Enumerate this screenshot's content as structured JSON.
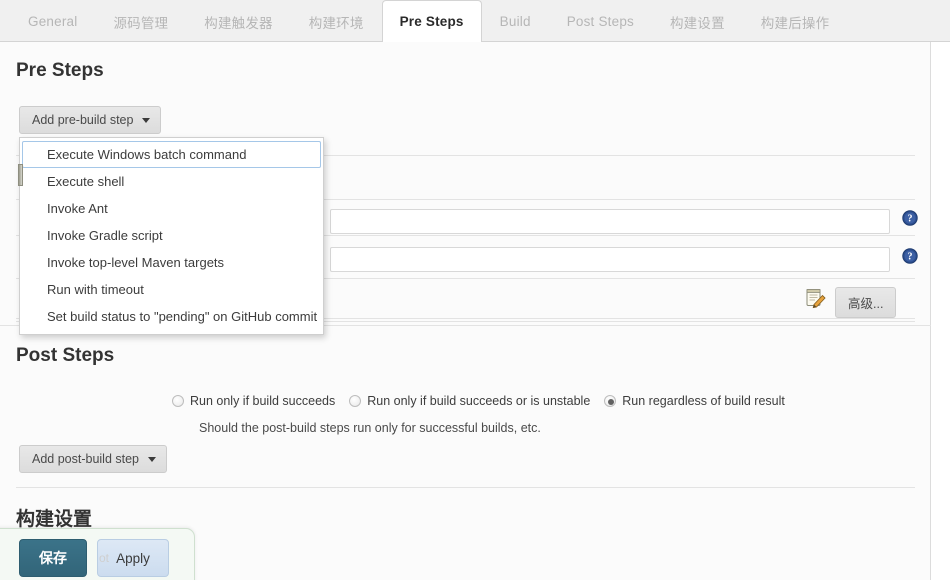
{
  "tabs": [
    {
      "label": "General",
      "active": false
    },
    {
      "label": "源码管理",
      "active": false
    },
    {
      "label": "构建触发器",
      "active": false
    },
    {
      "label": "构建环境",
      "active": false
    },
    {
      "label": "Pre Steps",
      "active": true
    },
    {
      "label": "Build",
      "active": false
    },
    {
      "label": "Post Steps",
      "active": false
    },
    {
      "label": "构建设置",
      "active": false
    },
    {
      "label": "构建后操作",
      "active": false
    }
  ],
  "pre_steps": {
    "heading": "Pre Steps",
    "add_button_label": "Add pre-build step",
    "menu": {
      "items": [
        {
          "label": "Execute Windows batch command",
          "highlighted": true
        },
        {
          "label": "Execute shell",
          "highlighted": false
        },
        {
          "label": "Invoke Ant",
          "highlighted": false
        },
        {
          "label": "Invoke Gradle script",
          "highlighted": false
        },
        {
          "label": "Invoke top-level Maven targets",
          "highlighted": false
        },
        {
          "label": "Run with timeout",
          "highlighted": false
        },
        {
          "label": "Set build status to \"pending\" on GitHub commit",
          "highlighted": false
        }
      ]
    },
    "fields": [
      {
        "value": "",
        "placeholder": ""
      },
      {
        "value": "",
        "placeholder": ""
      }
    ],
    "advanced_button_label": "高级..."
  },
  "post_steps": {
    "heading": "Post Steps",
    "run_conditions": [
      {
        "label": "Run only if build succeeds",
        "selected": false
      },
      {
        "label": "Run only if build succeeds or is unstable",
        "selected": false
      },
      {
        "label": "Run regardless of build result",
        "selected": true
      }
    ],
    "hint": "Should the post-build steps run only for successful builds, etc.",
    "add_button_label": "Add post-build step"
  },
  "build_settings": {
    "heading": "构建设置"
  },
  "savebar": {
    "save_label": "保存",
    "apply_label": "Apply",
    "ghost_label": "ot"
  },
  "icons": {
    "help": "help-question-icon",
    "note": "notepad-pencil-icon",
    "caret": "chevron-down-icon"
  },
  "colors": {
    "active_tab_text": "#2b2b2b",
    "inactive_tab_text": "#b6b6b6",
    "save_button": "#366b80",
    "apply_button": "#d2e0f0",
    "help_icon": "#2d4f91",
    "page_background": "#fbfbfb"
  }
}
